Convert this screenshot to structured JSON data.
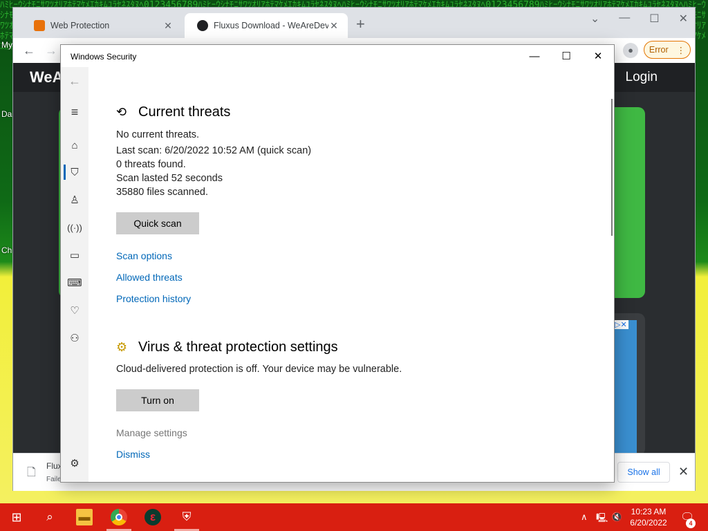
{
  "desktop": {
    "labels": [
      "My",
      "Da",
      "Ch"
    ]
  },
  "browser": {
    "tabs": [
      {
        "label": "Web Protection",
        "favicon_color": "#e8710a"
      },
      {
        "label": "Fluxus Download - WeAreDevs",
        "favicon_color": "#202124"
      }
    ],
    "new_tab": "+",
    "error_label": "Error",
    "site": {
      "logo": "WeA",
      "login": "Login"
    },
    "download": {
      "name": "Flux",
      "status": "Faile",
      "show_all": "Show all"
    }
  },
  "windows_security": {
    "title": "Windows Security",
    "current_threats": {
      "heading": "Current threats",
      "lines": [
        "No current threats.",
        "Last scan: 6/20/2022 10:52 AM (quick scan)",
        "0 threats found.",
        "Scan lasted 52 seconds",
        "35880 files scanned."
      ],
      "button": "Quick scan",
      "links": [
        "Scan options",
        "Allowed threats",
        "Protection history"
      ]
    },
    "settings": {
      "heading": "Virus & threat protection settings",
      "message": "Cloud-delivered protection is off. Your device may be vulnerable.",
      "button": "Turn on",
      "manage": "Manage settings",
      "dismiss": "Dismiss"
    },
    "sidebar_icons": [
      "back-icon",
      "menu-icon",
      "home-icon",
      "shield-icon",
      "account-icon",
      "firewall-icon",
      "app-browser-icon",
      "device-security-icon",
      "health-icon",
      "family-icon",
      "settings-icon"
    ],
    "accent_color": "#0067b8"
  },
  "taskbar": {
    "time": "10:23 AM",
    "date": "6/20/2022",
    "notifications": "4",
    "color": "#d91f11"
  }
}
